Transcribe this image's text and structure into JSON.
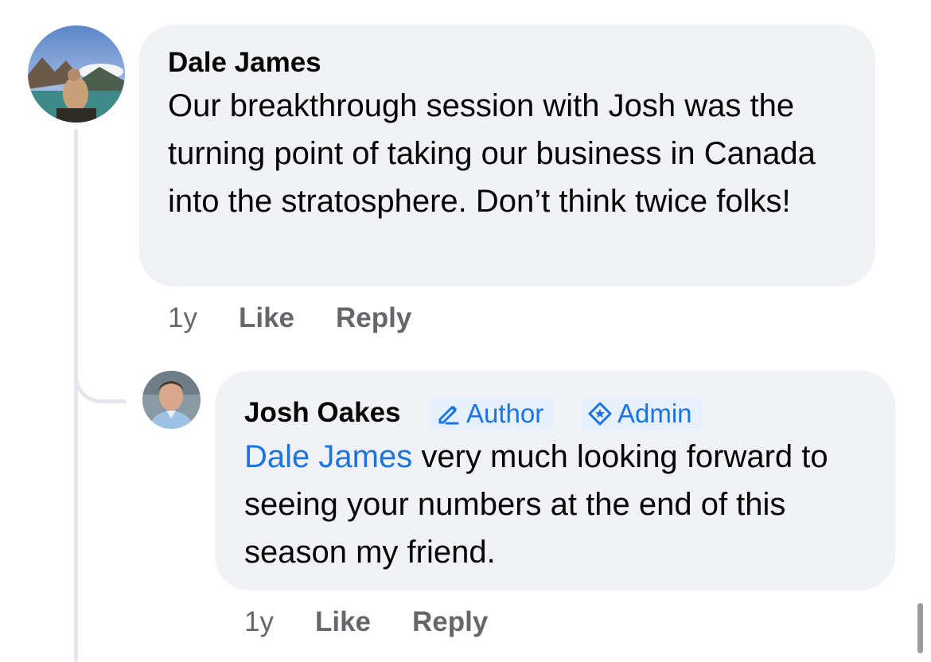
{
  "comments": [
    {
      "author": "Dale James",
      "text": "Our breakthrough session with Josh was the turning point of taking our business in Canada into the stratosphere. Don’t think twice folks!",
      "time": "1y",
      "like_label": "Like",
      "reply_label": "Reply"
    }
  ],
  "reply": {
    "author": "Josh Oakes",
    "badges": [
      {
        "label": "Author",
        "icon": "pencil-icon"
      },
      {
        "label": "Admin",
        "icon": "star-badge-icon"
      }
    ],
    "mention": "Dale James",
    "text": " very much looking forward to seeing your numbers at the end of this season my friend.",
    "time": "1y",
    "like_label": "Like",
    "reply_label": "Reply"
  },
  "colors": {
    "bubble": "#f0f2f5",
    "link": "#1b74e4",
    "meta": "#65676b",
    "thread_line": "#e4e6eb"
  }
}
